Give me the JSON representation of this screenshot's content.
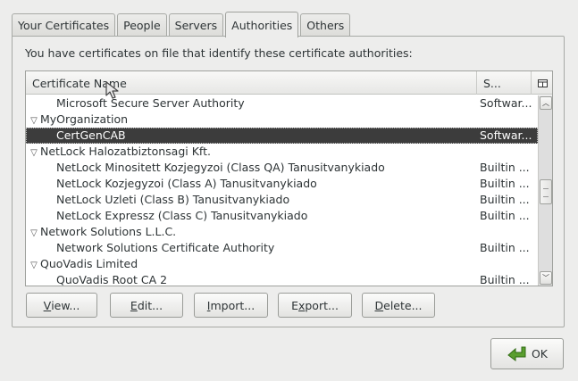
{
  "tabs": [
    {
      "label": "Your Certificates",
      "active": false
    },
    {
      "label": "People",
      "active": false
    },
    {
      "label": "Servers",
      "active": false
    },
    {
      "label": "Authorities",
      "active": true
    },
    {
      "label": "Others",
      "active": false
    }
  ],
  "intro_text": "You have certificates on file that identify these certificate authorities:",
  "table": {
    "headers": {
      "name": "Certificate Name",
      "security": "S..."
    },
    "rows": [
      {
        "name": "Microsoft Secure Server Authority",
        "security": "Softwar..."
      },
      {
        "name": "MyOrganization",
        "security": ""
      },
      {
        "name": "CertGenCAB",
        "security": "Softwar..."
      },
      {
        "name": "NetLock Halozatbiztonsagi Kft.",
        "security": ""
      },
      {
        "name": "NetLock Minositett Kozjegyzoi (Class QA) Tanusitvanykiado",
        "security": "Builtin ..."
      },
      {
        "name": "NetLock Kozjegyzoi (Class A) Tanusitvanykiado",
        "security": "Builtin ..."
      },
      {
        "name": "NetLock Uzleti (Class B) Tanusitvanykiado",
        "security": "Builtin ..."
      },
      {
        "name": "NetLock Expressz (Class C) Tanusitvanykiado",
        "security": "Builtin ..."
      },
      {
        "name": "Network Solutions L.L.C.",
        "security": ""
      },
      {
        "name": "Network Solutions Certificate Authority",
        "security": "Builtin ..."
      },
      {
        "name": "QuoVadis Limited",
        "security": ""
      },
      {
        "name": "QuoVadis Root CA 2",
        "security": "Builtin ..."
      }
    ]
  },
  "buttons": {
    "view": {
      "mnemonic": "V",
      "rest": "iew..."
    },
    "edit": {
      "mnemonic": "E",
      "rest": "dit..."
    },
    "import": {
      "mnemonic": "I",
      "rest": "mport..."
    },
    "export": {
      "pre": "E",
      "mnemonic": "x",
      "rest": "port..."
    },
    "delete": {
      "mnemonic": "D",
      "rest": "elete..."
    },
    "ok": "OK"
  },
  "colors": {
    "selected_row": "#3c3c3c",
    "ok_arrow": "#5a9e2f"
  }
}
